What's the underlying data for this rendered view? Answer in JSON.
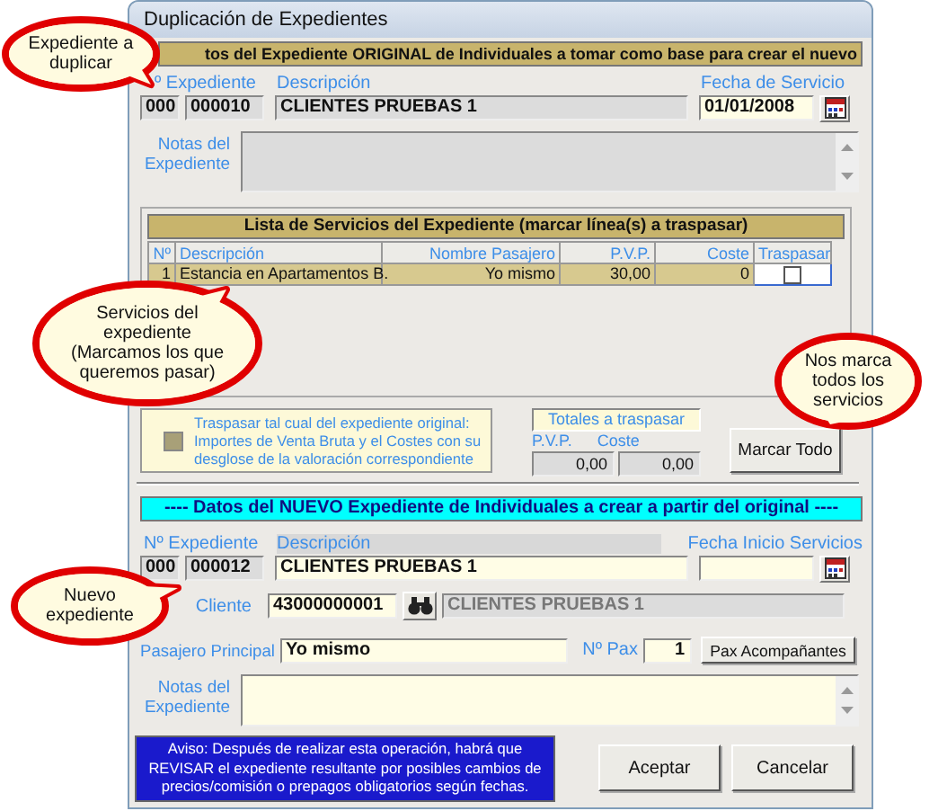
{
  "window": {
    "title": "Duplicación de Expedientes"
  },
  "original": {
    "header": "tos del Expediente ORIGINAL de Individuales a tomar como base para crear el nuevo",
    "number_label": "º Expediente",
    "description_label": "Descripción",
    "date_label": "Fecha de Servicio",
    "notes_label": "Notas del Expediente",
    "prefix": {
      "value": "000",
      "disabled": true
    },
    "number": {
      "value": "000010",
      "disabled": true
    },
    "description": {
      "value": "CLIENTES PRUEBAS 1",
      "disabled": true
    },
    "date": {
      "value": "01/01/2008",
      "disabled": false
    },
    "notes": {
      "disabled": true
    }
  },
  "services": {
    "header": "Lista de Servicios del Expediente (marcar línea(s) a traspasar)",
    "columns": [
      "Nº",
      "Descripción",
      "Nombre Pasajero",
      "P.V.P.",
      "Coste",
      "Traspasar"
    ],
    "rows": [
      {
        "number": "1",
        "description": "Estancia en Apartamentos B.",
        "passenger": "Yo mismo",
        "pvp": "30,00",
        "cost": "0",
        "transfer": false,
        "selected": true
      }
    ]
  },
  "transfer_as_is": {
    "label": "Traspasar tal cual del expediente original: Importes de Venta Bruta y el Costes con su desglose de la valoración correspondiente",
    "checked": false,
    "disabled": true
  },
  "totals": {
    "title": "Totales a traspasar",
    "pvp_label": "P.V.P.",
    "cost_label": "Coste",
    "pvp": "0,00",
    "cost": "0,00"
  },
  "mark_all_button": "Marcar Todo",
  "new": {
    "header": "---- Datos del NUEVO Expediente de Individuales a crear a partir del original ----",
    "number_label": "Nº Expediente",
    "description_label": "Descripción",
    "date_label": "Fecha Inicio Servicios",
    "client_label": "Cliente",
    "passenger_label": "Pasajero Principal",
    "pax_label": "Nº Pax",
    "notes_label": "Notas del Expediente",
    "prefix": {
      "value": "000",
      "disabled": true
    },
    "number": {
      "value": "000012",
      "disabled": true
    },
    "description": {
      "value": "CLIENTES PRUEBAS 1",
      "disabled": false
    },
    "date": {
      "disabled": false
    },
    "client_code": {
      "value": "43000000001",
      "disabled": false
    },
    "client_name": {
      "value": "CLIENTES PRUEBAS 1",
      "disabled": true
    },
    "passenger": {
      "value": "Yo mismo",
      "disabled": false
    },
    "pax": {
      "value": "1",
      "disabled": false
    },
    "notes": {
      "disabled": false
    }
  },
  "companions_button": "Pax Acompañantes",
  "warning": "Aviso: Después de realizar esta operación, habrá que REVISAR el expediente resultante por posibles cambios de precios/comisión o prepagos obligatorios según fechas.",
  "buttons": [
    "Aceptar",
    "Cancelar"
  ],
  "callouts": [
    "Expediente a duplicar",
    "Servicios del expediente (Marcamos los que queremos pasar)",
    "Nos marca todos los servicios",
    "Nuevo expediente"
  ]
}
